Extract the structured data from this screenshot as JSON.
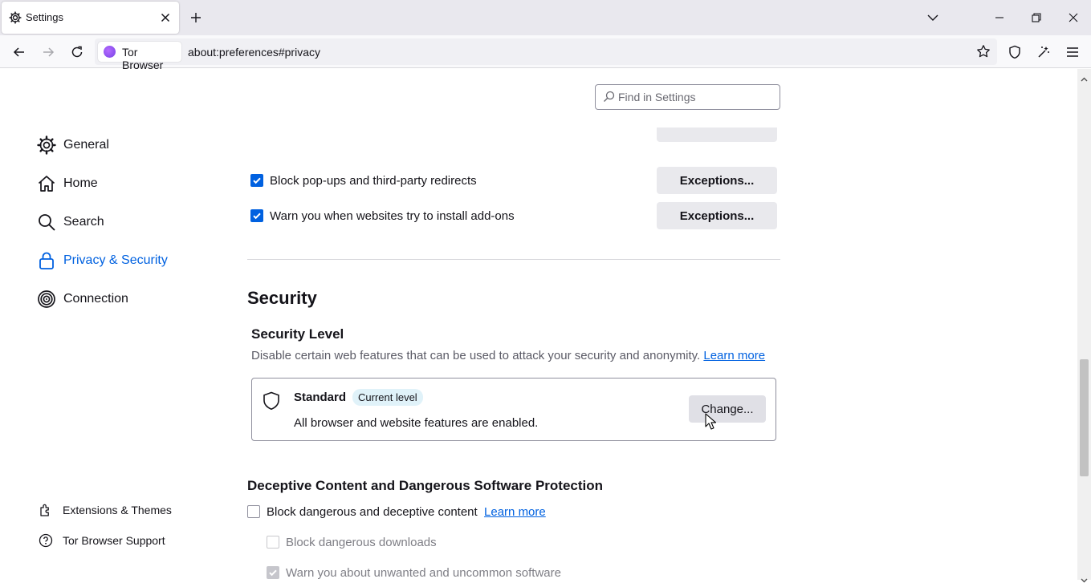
{
  "tab": {
    "title": "Settings"
  },
  "navbar": {
    "identity_label": "Tor Browser",
    "url": "about:preferences#privacy"
  },
  "search": {
    "placeholder": "Find in Settings"
  },
  "sidebar": {
    "items": [
      {
        "label": "General",
        "icon": "gear-icon"
      },
      {
        "label": "Home",
        "icon": "home-icon"
      },
      {
        "label": "Search",
        "icon": "search-icon"
      },
      {
        "label": "Privacy & Security",
        "icon": "lock-icon",
        "selected": true
      },
      {
        "label": "Connection",
        "icon": "onion-icon"
      }
    ],
    "footer": [
      {
        "label": "Extensions & Themes",
        "icon": "puzzle-icon"
      },
      {
        "label": "Tor Browser Support",
        "icon": "help-icon"
      }
    ]
  },
  "permissions": {
    "popups": {
      "label": "Block pop-ups and third-party redirects",
      "checked": true,
      "button": "Exceptions..."
    },
    "addons": {
      "label": "Warn you when websites try to install add-ons",
      "checked": true,
      "button": "Exceptions..."
    }
  },
  "security": {
    "heading": "Security",
    "level_heading": "Security Level",
    "description": "Disable certain web features that can be used to attack your security and anonymity.",
    "learn_more": "Learn more",
    "current": {
      "name": "Standard",
      "badge": "Current level",
      "detail": "All browser and website features are enabled.",
      "change_button": "Change..."
    }
  },
  "deceptive": {
    "heading": "Deceptive Content and Dangerous Software Protection",
    "block": {
      "label": "Block dangerous and deceptive content",
      "checked": false,
      "learn_more": "Learn more"
    },
    "downloads": {
      "label": "Block dangerous downloads",
      "checked": false
    },
    "unwanted": {
      "label": "Warn you about unwanted and uncommon software",
      "checked": true
    }
  },
  "colors": {
    "accent": "#0061e0",
    "badge_bg": "#e0f2f9",
    "button_bg": "#e9e9ed"
  }
}
